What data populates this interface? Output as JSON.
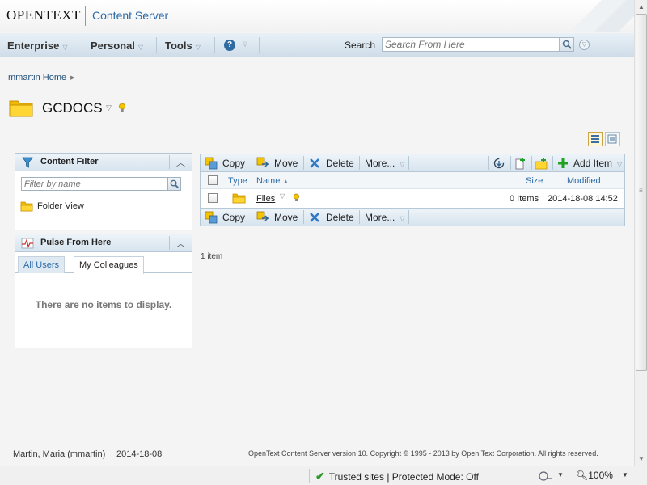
{
  "header": {
    "brand": "OPENTEXT",
    "product": "Content Server"
  },
  "nav": {
    "menus": [
      "Enterprise",
      "Personal",
      "Tools"
    ],
    "search_label": "Search",
    "search_placeholder": "Search From Here"
  },
  "breadcrumb": {
    "home": "mmartin Home"
  },
  "page": {
    "title": "GCDOCS",
    "item_count": "1 item"
  },
  "content_filter": {
    "title": "Content Filter",
    "filter_placeholder": "Filter by name",
    "folder_view": "Folder View"
  },
  "pulse": {
    "title": "Pulse From Here",
    "tabs": [
      "All Users",
      "My Colleagues"
    ],
    "empty_message": "There are no items to display."
  },
  "toolbar": {
    "copy": "Copy",
    "move": "Move",
    "delete": "Delete",
    "more": "More...",
    "add_item": "Add Item"
  },
  "table": {
    "columns": {
      "type": "Type",
      "name": "Name",
      "size": "Size",
      "modified": "Modified"
    },
    "rows": [
      {
        "name": "Files",
        "size": "0 Items",
        "modified": "2014-18-08 14:52"
      }
    ]
  },
  "footer": {
    "user": "Martin, Maria (mmartin)",
    "date": "2014-18-08",
    "copyright": "OpenText Content Server version 10. Copyright © 1995 - 2013 by Open Text Corporation. All rights reserved."
  },
  "statusbar": {
    "zone": "Trusted sites | Protected Mode: Off",
    "zoom": "100%"
  },
  "colors": {
    "link_blue": "#2a6aa6",
    "folder_yellow": "#f5c400",
    "nav_bg": "#d6e3ee"
  }
}
